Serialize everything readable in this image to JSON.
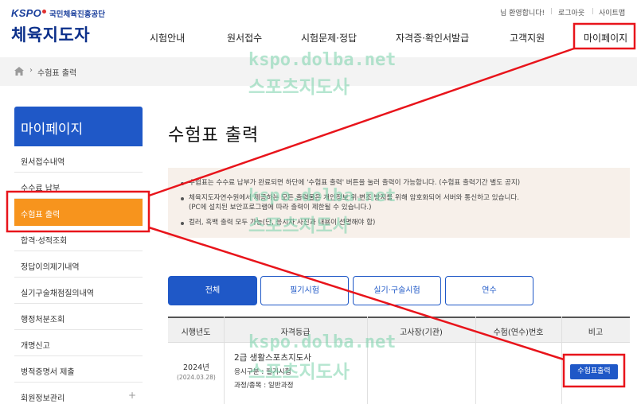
{
  "header": {
    "logo_kspo": "KSPO",
    "logo_org": "국민체육진흥공단",
    "brand": "체육지도자",
    "util": {
      "welcome": "님 환영합니다!",
      "logout": "로그아웃",
      "sitemap": "사이트맵"
    },
    "nav": [
      "시험안내",
      "원서접수",
      "시험문제·정답",
      "자격증·확인서발급",
      "고객지원",
      "마이페이지"
    ]
  },
  "breadcrumb": {
    "home_icon": "home-icon",
    "current": "수험표 출력"
  },
  "sidebar": {
    "title": "마이페이지",
    "items": [
      {
        "label": "원서접수내역"
      },
      {
        "label": "수수료 납부"
      },
      {
        "label": "수험표 출력",
        "active": true
      },
      {
        "label": "합격·성적조회"
      },
      {
        "label": "정답이의제기내역"
      },
      {
        "label": "실기구술채점질의내역"
      },
      {
        "label": "행정처분조회"
      },
      {
        "label": "개명신고"
      },
      {
        "label": "병적증명서 제출"
      },
      {
        "label": "회원정보관리",
        "expand_icon": "plus-icon"
      }
    ]
  },
  "main": {
    "title": "수험표 출력",
    "notices": [
      "수험표는 수수료 납부가 완료되면 하단에 '수험표 출력' 버튼을 눌러 출력이 가능합니다. (수험표 출력기간 별도 공지)",
      "체육지도자연수원에서 제공하는 모든 출력물은 개인정보 위·변조 방지를 위해 암호화되어 서버와 통신하고 있습니다.",
      "(PC에 설치된 보안프로그램에 따라 출력이 제한될 수 있습니다.)",
      "컬러, 흑백 출력 모두 가능(단, 응시자 사진과 내용이 선명해야 함)"
    ],
    "tabs": [
      {
        "label": "전체",
        "active": true
      },
      {
        "label": "필기시험"
      },
      {
        "label": "실기·구술시험"
      },
      {
        "label": "연수"
      }
    ],
    "table": {
      "headers": [
        "시행년도",
        "자격등급",
        "고사장(기관)",
        "수험(연수)번호",
        "비고"
      ],
      "rows": [
        {
          "year": "2024년",
          "date": "(2024.03.28)",
          "grade": "2급 생활스포츠지도사",
          "category": "응시구분 : 필기시험",
          "course": "과정/종목 : 일반과정",
          "button": "수험표출력"
        }
      ]
    }
  },
  "watermark": {
    "domain": "kspo.dolba.net",
    "text": "스포츠지도사"
  },
  "colors": {
    "primary": "#1f58c7",
    "active_menu": "#f7941d",
    "annotation": "#e8141b",
    "watermark": "#78d2aa"
  }
}
